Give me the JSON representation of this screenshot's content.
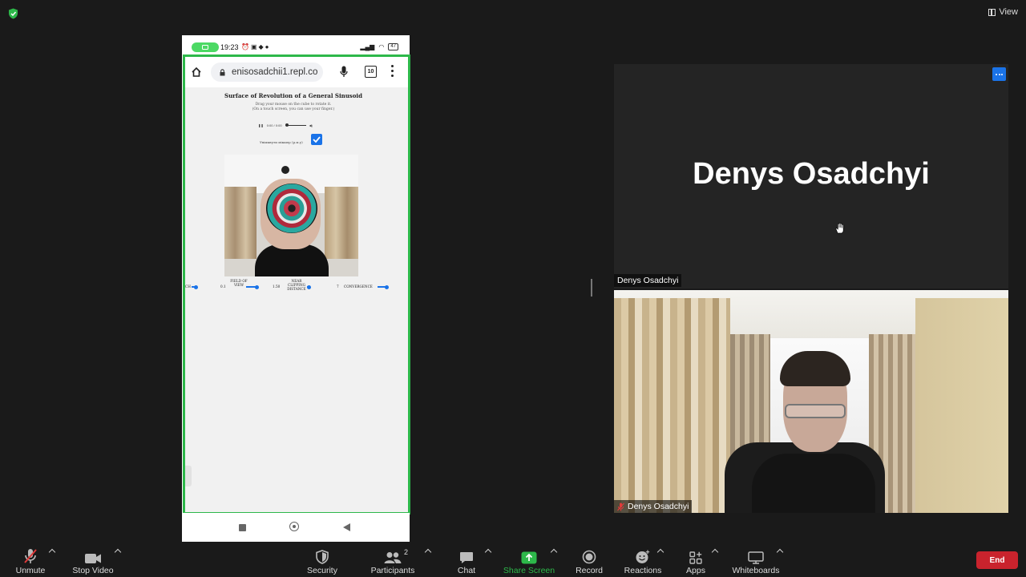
{
  "top": {
    "view_label": "View"
  },
  "phone": {
    "status": {
      "time": "19:23",
      "battery": "47"
    },
    "browser": {
      "url": "enisosadchii1.repl.co",
      "tab_count": "10"
    },
    "page": {
      "title": "Surface of Revolution of a General Sinusoid",
      "subtitle_1": "Drag your mouse on the cube to rotate it.",
      "subtitle_2": "(On a touch screen, you can use your finger.)",
      "player_time": "0:00 / 0:00",
      "checkbox_label": "Увімкнути мікшер (р.м.у)",
      "checkbox_checked": true,
      "sliders": [
        {
          "label": "CH",
          "value": ""
        },
        {
          "label": "FIELD OF VIEW",
          "value": "0.1"
        },
        {
          "label": "NEAR CLIPPING DISTANCE",
          "value": "1.50"
        },
        {
          "label": "CONVERGENCE",
          "value": "7"
        }
      ]
    }
  },
  "participants": {
    "name_tile": {
      "name": "Denys Osadchyi",
      "label": "Denys Osadchyi"
    },
    "video_tile": {
      "label": "Denys Osadchyi",
      "muted": true
    }
  },
  "toolbar": {
    "unmute": "Unmute",
    "stop_video": "Stop Video",
    "security": "Security",
    "participants": "Participants",
    "participants_count": "2",
    "chat": "Chat",
    "share_screen": "Share Screen",
    "record": "Record",
    "reactions": "Reactions",
    "apps": "Apps",
    "whiteboards": "Whiteboards",
    "end": "End"
  },
  "colors": {
    "share_green": "#2db84a",
    "end_red": "#c9232d",
    "accent_blue": "#1a73e8"
  }
}
